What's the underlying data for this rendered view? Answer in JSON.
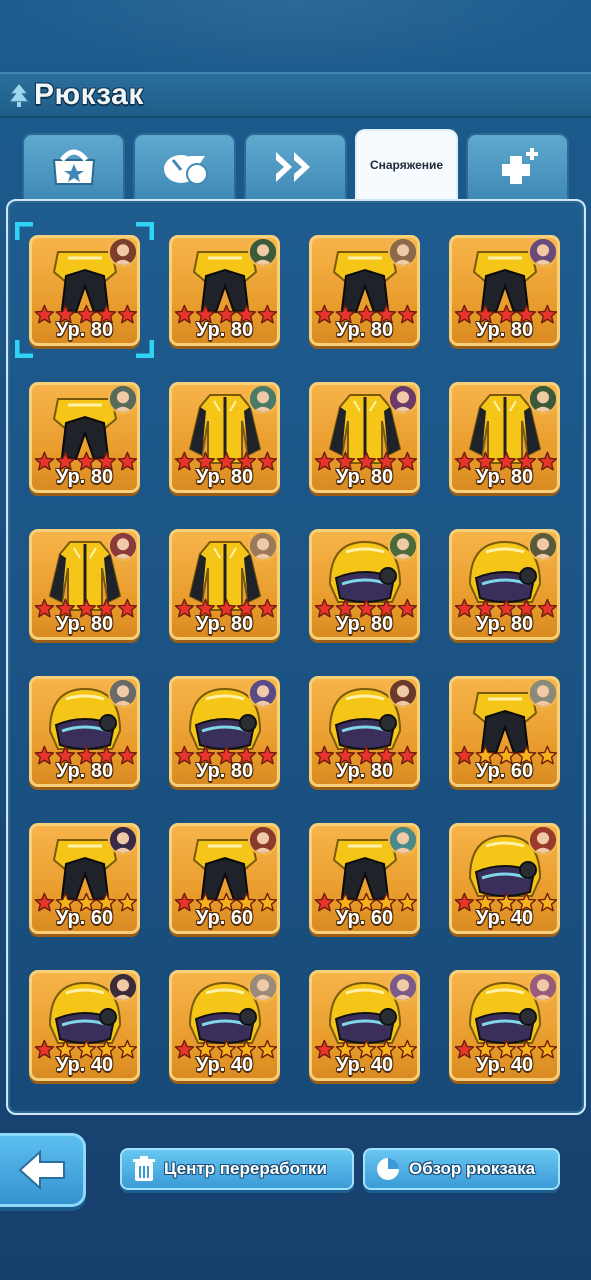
{
  "header": {
    "title": "Рюкзак"
  },
  "tabs": [
    {
      "icon": "chest-icon",
      "label": ""
    },
    {
      "icon": "food-icon",
      "label": ""
    },
    {
      "icon": "fast-forward-icon",
      "label": ""
    },
    {
      "icon": "",
      "label": "Снаряжение",
      "active": true
    },
    {
      "icon": "plus-cross-icon",
      "label": ""
    }
  ],
  "items": [
    {
      "type": "pants",
      "level": "Ур. 80",
      "stars": 5,
      "star_color": "red",
      "selected": true
    },
    {
      "type": "pants",
      "level": "Ур. 80",
      "stars": 5,
      "star_color": "red"
    },
    {
      "type": "pants",
      "level": "Ур. 80",
      "stars": 5,
      "star_color": "red"
    },
    {
      "type": "pants",
      "level": "Ур. 80",
      "stars": 5,
      "star_color": "red"
    },
    {
      "type": "pants",
      "level": "Ур. 80",
      "stars": 5,
      "star_color": "red"
    },
    {
      "type": "jacket",
      "level": "Ур. 80",
      "stars": 5,
      "star_color": "red"
    },
    {
      "type": "jacket",
      "level": "Ур. 80",
      "stars": 5,
      "star_color": "red"
    },
    {
      "type": "jacket",
      "level": "Ур. 80",
      "stars": 5,
      "star_color": "red"
    },
    {
      "type": "jacket",
      "level": "Ур. 80",
      "stars": 5,
      "star_color": "red"
    },
    {
      "type": "jacket",
      "level": "Ур. 80",
      "stars": 5,
      "star_color": "red"
    },
    {
      "type": "helmet",
      "level": "Ур. 80",
      "stars": 5,
      "star_color": "red"
    },
    {
      "type": "helmet",
      "level": "Ур. 80",
      "stars": 5,
      "star_color": "red"
    },
    {
      "type": "helmet",
      "level": "Ур. 80",
      "stars": 5,
      "star_color": "red"
    },
    {
      "type": "helmet",
      "level": "Ур. 80",
      "stars": 5,
      "star_color": "red"
    },
    {
      "type": "helmet",
      "level": "Ур. 80",
      "stars": 5,
      "star_color": "red"
    },
    {
      "type": "pants",
      "level": "Ур. 60",
      "stars": 5,
      "star_color": "mixed"
    },
    {
      "type": "pants",
      "level": "Ур. 60",
      "stars": 5,
      "star_color": "mixed"
    },
    {
      "type": "pants",
      "level": "Ур. 60",
      "stars": 5,
      "star_color": "mixed"
    },
    {
      "type": "pants",
      "level": "Ур. 60",
      "stars": 5,
      "star_color": "mixed"
    },
    {
      "type": "helmet",
      "level": "Ур. 40",
      "stars": 5,
      "star_color": "mixed"
    },
    {
      "type": "helmet",
      "level": "Ур. 40",
      "stars": 5,
      "star_color": "mixed"
    },
    {
      "type": "helmet",
      "level": "Ур. 40",
      "stars": 5,
      "star_color": "mixed"
    },
    {
      "type": "helmet",
      "level": "Ур. 40",
      "stars": 5,
      "star_color": "mixed"
    },
    {
      "type": "helmet",
      "level": "Ур. 40",
      "stars": 5,
      "star_color": "mixed"
    }
  ],
  "footer": {
    "back_icon": "back-arrow-icon",
    "recycle_label": "Центр переработки",
    "overview_label": "Обзор рюкзака"
  },
  "colors": {
    "accent": "#3a9bd6",
    "item_gold": "#f0a636",
    "star_red": "#e8342c",
    "star_gold": "#f6b21a"
  }
}
